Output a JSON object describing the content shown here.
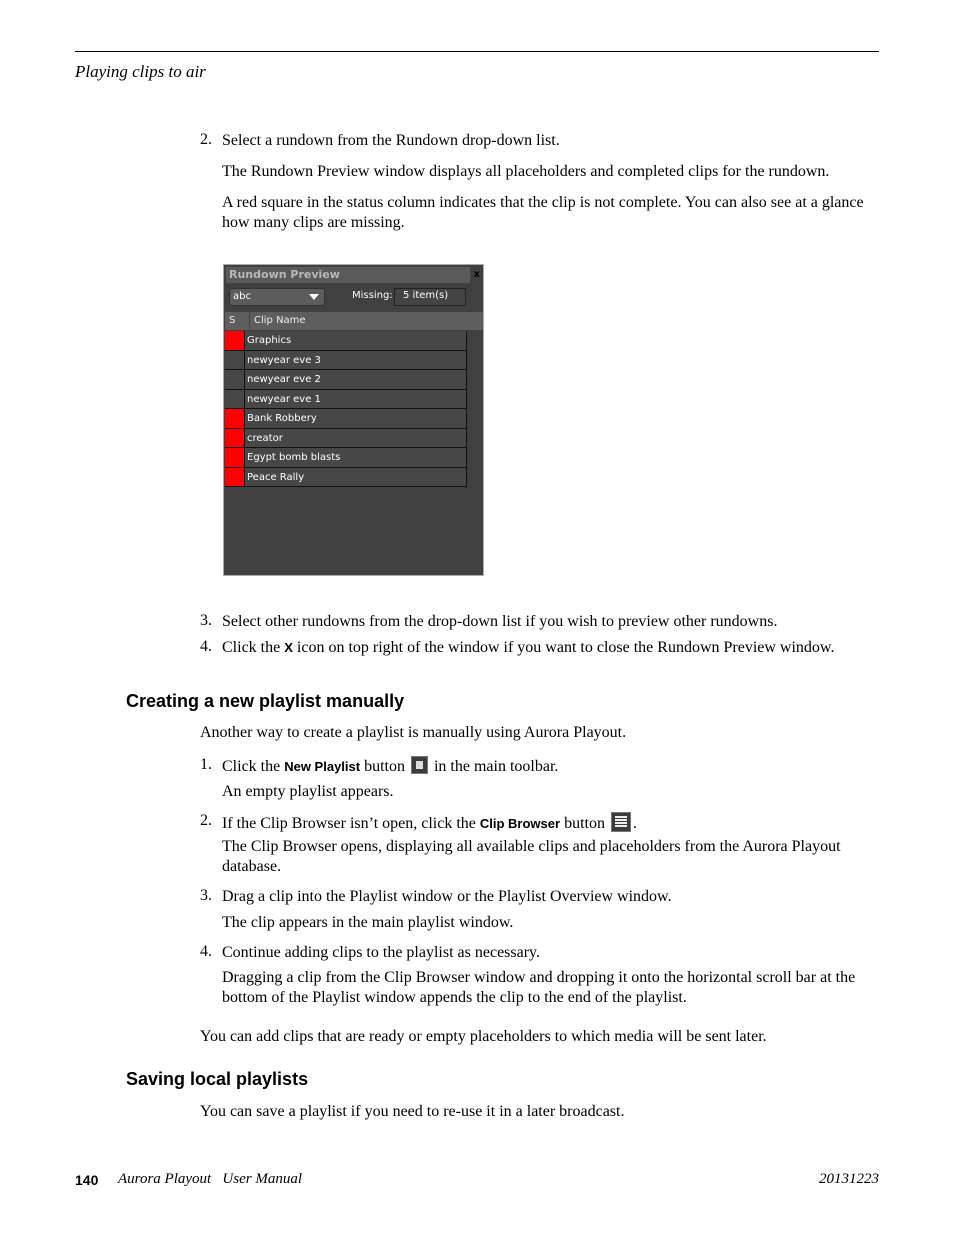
{
  "header": {
    "running_head": "Playing clips to air"
  },
  "steps_top": [
    {
      "number": "2.",
      "text": "Select a rundown from the Rundown drop-down list."
    },
    {
      "para1": "The Rundown Preview window displays all placeholders and completed clips for the rundown."
    },
    {
      "para2": "A red square in the status column indicates that the clip is not complete. You can also see at a glance how many clips are missing."
    }
  ],
  "rundown_window": {
    "title": "Rundown Preview",
    "close_label": "x",
    "rundown_select_value": "abc",
    "missing_label": "Missing:",
    "missing_value": "5 item(s)",
    "columns": {
      "status": "S",
      "clip_name": "Clip Name"
    },
    "status_colors": {
      "incomplete": "#ff0000",
      "complete": "#474747"
    },
    "rows": [
      {
        "name": "Graphics",
        "missing": true
      },
      {
        "name": "newyear eve 3",
        "missing": false
      },
      {
        "name": "newyear eve 2",
        "missing": false
      },
      {
        "name": "newyear eve 1",
        "missing": false
      },
      {
        "name": "Bank Robbery",
        "missing": true
      },
      {
        "name": "creator",
        "missing": true
      },
      {
        "name": "Egypt bomb blasts",
        "missing": true
      },
      {
        "name": "Peace Rally",
        "missing": true
      }
    ]
  },
  "steps_after": {
    "s3_num": "3.",
    "s3_text": "Select other rundowns from the drop-down list if you wish to preview other rundowns.",
    "s4_num": "4.",
    "s4_pre": "Click the ",
    "s4_bold": "X",
    "s4_post": " icon on top right of the window if you want to close the Rundown Preview window."
  },
  "section1": {
    "heading": "Creating a new playlist manually",
    "intro": "Another way to create a playlist is manually using Aurora Playout.",
    "step1_num": "1.",
    "step1_pre": "Click the ",
    "step1_bold": "New Playlist",
    "step1_mid": " button ",
    "step1_post": " in the main toolbar.",
    "step1_note": "An empty playlist appears.",
    "step2_num": "2.",
    "step2_pre": "If the Clip Browser isn’t open, click the ",
    "step2_bold": "Clip Browser",
    "step2_mid": " button ",
    "step2_post": ".",
    "step2_note": "The Clip Browser opens, displaying all available clips and placeholders from the Aurora Playout database.",
    "step3_num": "3.",
    "step3_text": "Drag a clip into the Playlist window or the Playlist Overview window.",
    "step3_note": "The clip appears in the main playlist window.",
    "step4_num": "4.",
    "step4_text": "Continue adding clips to the playlist as necessary.",
    "step4_note": "Dragging a clip from the Clip Browser window and dropping it onto the horizontal scroll bar at the bottom of the Playlist window appends the clip to the end of the playlist.",
    "outro": "You can add clips that are ready or empty placeholders to which media will be sent later."
  },
  "section2": {
    "heading": "Saving local playlists",
    "intro": "You can save a playlist if you need to re-use it in a later broadcast."
  },
  "footer": {
    "page_number": "140",
    "title": "Aurora Playout   User Manual",
    "date": "20131223"
  }
}
